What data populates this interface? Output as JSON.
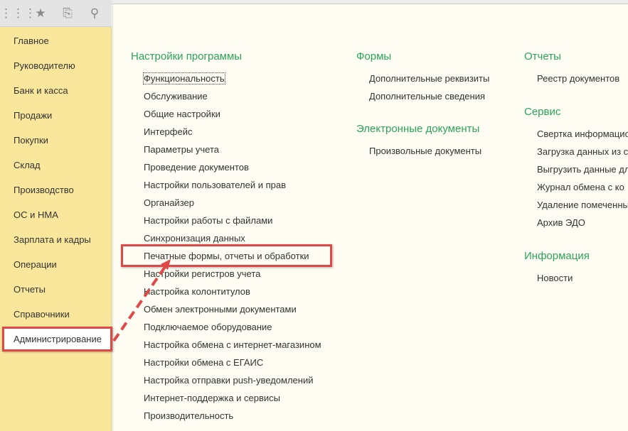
{
  "toolbar": {
    "icons": [
      "apps-grid-icon",
      "star-icon",
      "history-icon",
      "search-icon"
    ]
  },
  "sidebar": {
    "items": [
      "Главное",
      "Руководителю",
      "Банк и касса",
      "Продажи",
      "Покупки",
      "Склад",
      "Производство",
      "ОС и НМА",
      "Зарплата и кадры",
      "Операции",
      "Отчеты",
      "Справочники",
      "Администрирование"
    ],
    "active": "Администрирование"
  },
  "columns": [
    {
      "groups": [
        {
          "title": "Настройки программы",
          "items": [
            "Функциональность",
            "Обслуживание",
            "Общие настройки",
            "Интерфейс",
            "Параметры учета",
            "Проведение документов",
            "Настройки пользователей и прав",
            "Органайзер",
            "Настройки работы с файлами",
            "Синхронизация данных",
            "Печатные формы, отчеты и обработки",
            "Настройки регистров учета",
            "Настройка колонтитулов",
            "Обмен электронными документами",
            "Подключаемое оборудование",
            "Настройка обмена с интернет-магазином",
            "Настройки обмена с ЕГАИС",
            "Настройка отправки push-уведомлений",
            "Интернет-поддержка и сервисы",
            "Производительность"
          ]
        }
      ]
    },
    {
      "groups": [
        {
          "title": "Формы",
          "items": [
            "Дополнительные реквизиты",
            "Дополнительные сведения"
          ]
        },
        {
          "title": "Электронные документы",
          "items": [
            "Произвольные документы"
          ]
        }
      ]
    },
    {
      "groups": [
        {
          "title": "Отчеты",
          "items": [
            "Реестр документов"
          ]
        },
        {
          "title": "Сервис",
          "items": [
            "Свертка информацио",
            "Загрузка данных из с",
            "Выгрузить данные дл",
            "Журнал обмена с ко",
            "Удаление помеченны",
            "Архив ЭДО"
          ]
        },
        {
          "title": "Информация",
          "items": [
            "Новости"
          ]
        }
      ]
    }
  ],
  "highlight_color": "#e04848",
  "group_title_color": "#2ea35a"
}
